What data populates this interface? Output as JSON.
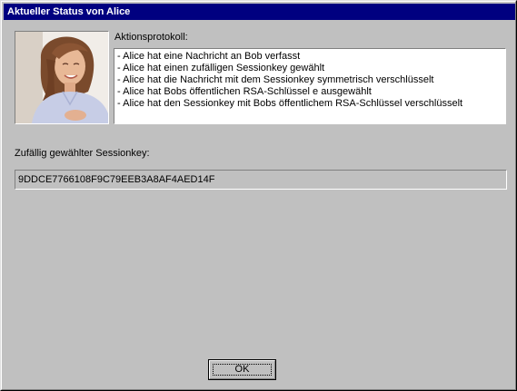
{
  "window": {
    "title": "Aktueller Status von Alice"
  },
  "log": {
    "label": "Aktionsprotokoll:",
    "entries": [
      "- Alice hat eine Nachricht an Bob verfasst",
      "- Alice hat einen zufälligen Sessionkey gewählt",
      "- Alice hat die Nachricht mit dem Sessionkey symmetrisch verschlüsselt",
      "- Alice hat Bobs öffentlichen RSA-Schlüssel e ausgewählt",
      "- Alice hat den Sessionkey mit Bobs öffentlichem RSA-Schlüssel verschlüsselt"
    ]
  },
  "sessionkey": {
    "label": "Zufällig gewählter Sessionkey:",
    "value": "9DDCE7766108F9C79EEB3A8AF4AED14F"
  },
  "buttons": {
    "ok": "OK"
  }
}
